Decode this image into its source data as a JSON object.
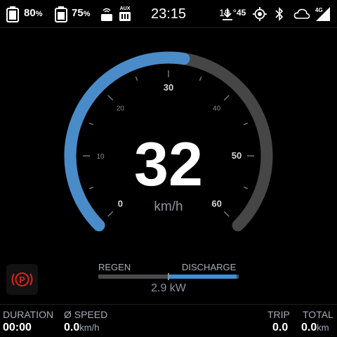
{
  "status_bar": {
    "battery_1": "80",
    "battery_2": "75",
    "percent_sign": "%",
    "aux_label": "AUX",
    "clock": "23:15",
    "temperature": "19 °",
    "download_count": "45",
    "network": "4G"
  },
  "gauge": {
    "speed": "32",
    "unit": "km/h",
    "max_speed": 60,
    "tick_labels": [
      "0",
      "10",
      "20",
      "30",
      "40",
      "50",
      "60"
    ],
    "colors": {
      "active": "#4a8cc9",
      "track": "#464646",
      "ticks": "#7c7c7c"
    }
  },
  "parking": {
    "symbol": "P",
    "color": "#e0201b"
  },
  "power": {
    "regen_label": "REGEN",
    "discharge_label": "DISCHARGE",
    "value": "2.9 kW",
    "discharge_fraction": 0.97
  },
  "stats": {
    "duration_label": "DURATION",
    "duration_value": "00:00",
    "avg_speed_label": "Ø SPEED",
    "avg_speed_value": "0.0",
    "avg_speed_unit": "km/h",
    "trip_label": "TRIP",
    "trip_value": "0.0",
    "total_label": "TOTAL",
    "total_value": "0.0",
    "total_unit": "km"
  }
}
